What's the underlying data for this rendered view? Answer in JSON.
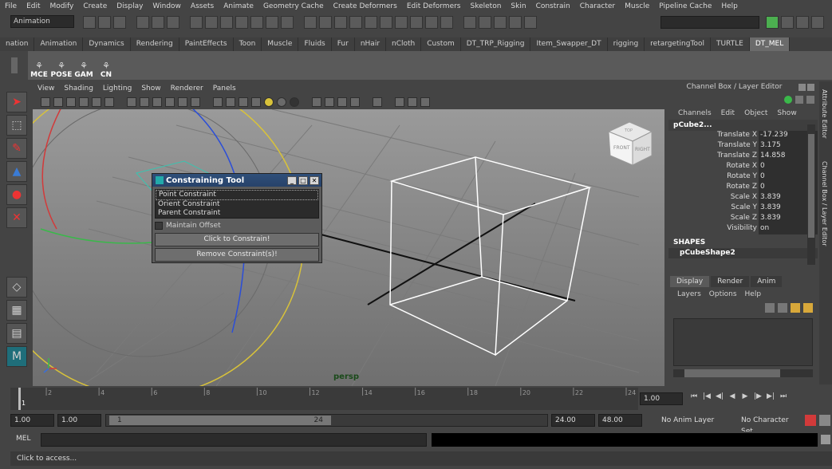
{
  "menus": [
    "File",
    "Edit",
    "Modify",
    "Create",
    "Display",
    "Window",
    "Assets",
    "Animate",
    "Geometry Cache",
    "Create Deformers",
    "Edit Deformers",
    "Skeleton",
    "Skin",
    "Constrain",
    "Character",
    "Muscle",
    "Pipeline Cache",
    "Help"
  ],
  "mode_select": "Animation",
  "shelf_tabs": [
    "nation",
    "Animation",
    "Dynamics",
    "Rendering",
    "PaintEffects",
    "Toon",
    "Muscle",
    "Fluids",
    "Fur",
    "nHair",
    "nCloth",
    "Custom",
    "DT_TRP_Rigging",
    "Item_Swapper_DT",
    "rigging",
    "retargetingTool",
    "TURTLE",
    "DT_MEL"
  ],
  "active_shelf_tab": "DT_MEL",
  "shelf_buttons": [
    "MCE",
    "POSE",
    "GAM",
    "CN"
  ],
  "viewport_menu": [
    "View",
    "Shading",
    "Lighting",
    "Show",
    "Renderer",
    "Panels"
  ],
  "viewport_label": "persp",
  "viewcube": {
    "front": "FRONT",
    "right": "RIGHT",
    "top": "TOP"
  },
  "dialog": {
    "title": "Constraining Tool",
    "list": [
      "Point Constraint",
      "Orient Constraint",
      "Parent Constraint"
    ],
    "checkbox_label": "Maintain Offset",
    "buttons": [
      "Click to Constrain!",
      "Remove Constraint(s)!"
    ]
  },
  "channel_box": {
    "title": "Channel Box / Layer Editor",
    "menu": [
      "Channels",
      "Edit",
      "Object",
      "Show"
    ],
    "object": "pCube2...",
    "channels": [
      {
        "label": "Translate X",
        "value": "-17.239"
      },
      {
        "label": "Translate Y",
        "value": "3.175"
      },
      {
        "label": "Translate Z",
        "value": "14.858"
      },
      {
        "label": "Rotate X",
        "value": "0"
      },
      {
        "label": "Rotate Y",
        "value": "0"
      },
      {
        "label": "Rotate Z",
        "value": "0"
      },
      {
        "label": "Scale X",
        "value": "3.839"
      },
      {
        "label": "Scale Y",
        "value": "3.839"
      },
      {
        "label": "Scale Z",
        "value": "3.839"
      },
      {
        "label": "Visibility",
        "value": "on"
      }
    ],
    "shapes_header": "SHAPES",
    "shape": "pCubeShape2"
  },
  "layer_editor": {
    "tabs": [
      "Display",
      "Render",
      "Anim"
    ],
    "menu": [
      "Layers",
      "Options",
      "Help"
    ]
  },
  "side_tabs": [
    "Attribute Editor",
    "Channel Box / Layer Editor"
  ],
  "timeline": {
    "ticks": [
      "1",
      "2",
      "4",
      "6",
      "8",
      "10",
      "12",
      "14",
      "16",
      "18",
      "20",
      "22",
      "24"
    ],
    "current_frame": "1.00"
  },
  "range": {
    "start": "1.00",
    "anim_start": "1.00",
    "slider_start": "1",
    "slider_end": "24",
    "end": "24.00",
    "anim_end": "48.00",
    "anim_layer": "No Anim Layer",
    "character_set": "No Character Set"
  },
  "mel_label": "MEL",
  "help_text": "Click to access...",
  "colors": {
    "accent": "#27426a",
    "viewport_bg": "#8a8a8a"
  }
}
